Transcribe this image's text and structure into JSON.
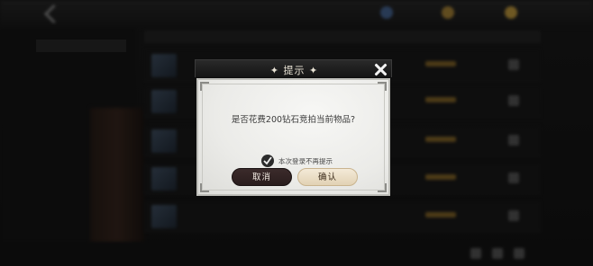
{
  "background": {
    "top_title": "",
    "resources": [
      "",
      "",
      ""
    ],
    "side_items": [
      "",
      ""
    ],
    "row_count": 5
  },
  "dialog": {
    "title": "提示",
    "question": "是否花费200钻石竞拍当前物品?",
    "remember_label": "本次登录不再提示",
    "remember_checked": true,
    "cancel_label": "取消",
    "confirm_label": "确认"
  },
  "colors": {
    "cancel_bg": "#2f2222",
    "confirm_bg": "#efe3cc",
    "panel_bg": "#f2f2f0",
    "header_bg": "#1c1c1c"
  },
  "icons": {
    "close": "close-icon",
    "check": "checkmark-icon",
    "back": "back-arrow-icon"
  }
}
